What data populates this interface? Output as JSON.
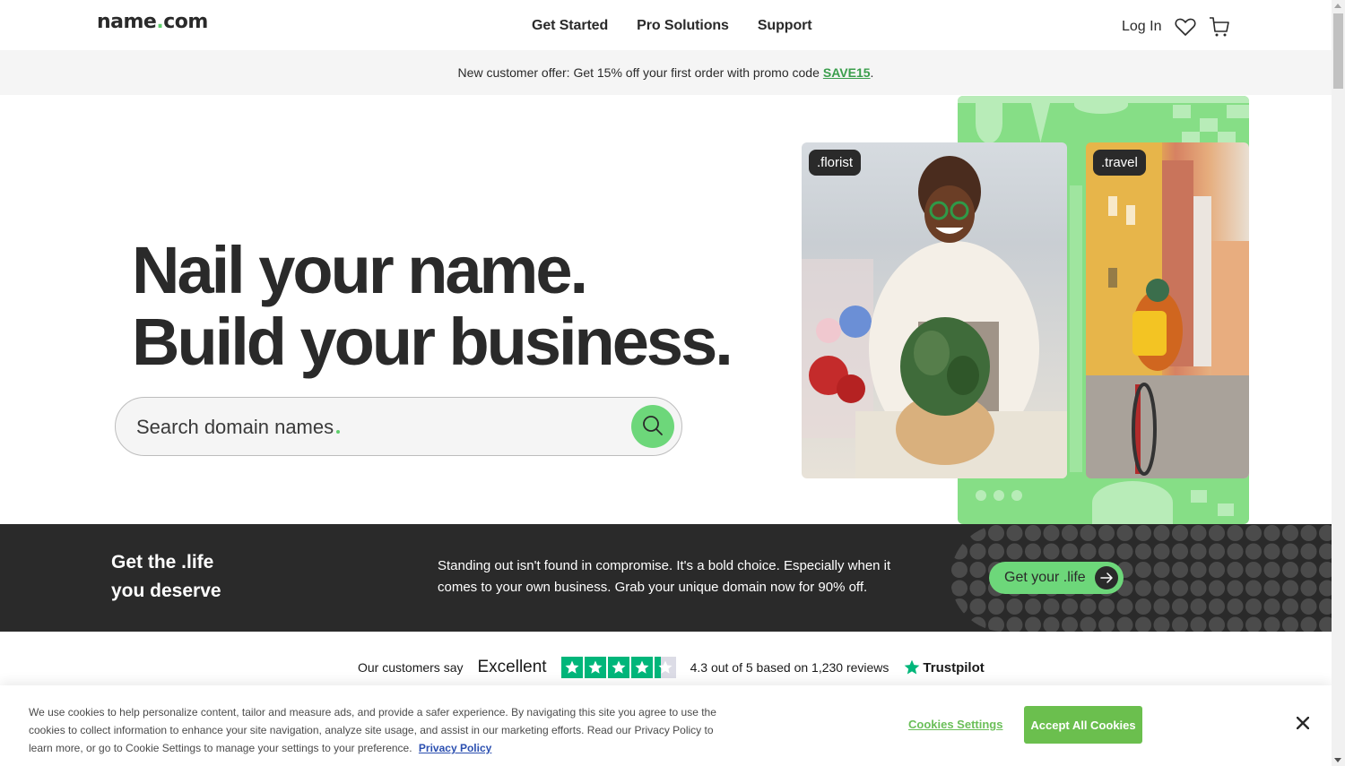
{
  "header": {
    "logo_text": "name",
    "logo_dot": ".",
    "logo_suffix": "com",
    "nav": [
      {
        "label": "Get Started"
      },
      {
        "label": "Pro Solutions"
      },
      {
        "label": "Support"
      }
    ],
    "login_label": "Log In",
    "icons": {
      "favorites": "heart-icon",
      "cart": "cart-icon"
    }
  },
  "promo": {
    "text": "New customer offer: Get 15% off your first order with promo code",
    "code": "SAVE15",
    "trailing": "."
  },
  "hero": {
    "title_line1": "Nail your name.",
    "title_line2": "Build your business.",
    "search": {
      "placeholder": "Search domain names",
      "value": "",
      "button_icon": "search-icon"
    },
    "images": [
      {
        "tag": ".florist",
        "alt": "Smiling florist arranging a potted plant"
      },
      {
        "tag": ".travel",
        "alt": "Cyclist with yellow backpack on cobblestone street"
      }
    ]
  },
  "life_band": {
    "title_line1": "Get the .life",
    "title_line2": "you deserve",
    "text": "Standing out isn't found in compromise. It's a bold choice. Especially when it comes to your own business. Grab your unique domain now for 90% off.",
    "button_label": "Get your .life"
  },
  "trustpilot": {
    "lead": "Our customers say",
    "rating_word": "Excellent",
    "stars": 4.3,
    "max_stars": 5,
    "summary": "4.3 out of 5 based on 1,230 reviews",
    "brand": "Trustpilot"
  },
  "cookie_banner": {
    "text": "We use cookies to help personalize content, tailor and measure ads, and provide a safer experience. By navigating this site you agree to use the cookies to collect information to enhance your site navigation, analyze site usage, and assist in our marketing efforts. Read our Privacy Policy to learn more, or go to Cookie Settings to manage your settings to your preference.",
    "privacy_link": "Privacy Policy",
    "settings_label": "Cookies Settings",
    "accept_label": "Accept All Cookies"
  },
  "colors": {
    "brand_green": "#6dd77a",
    "dark": "#2a2a2a",
    "promo_code": "#3a9e4c",
    "accept_green": "#6bbf4e",
    "trustpilot_green": "#00b67a"
  }
}
